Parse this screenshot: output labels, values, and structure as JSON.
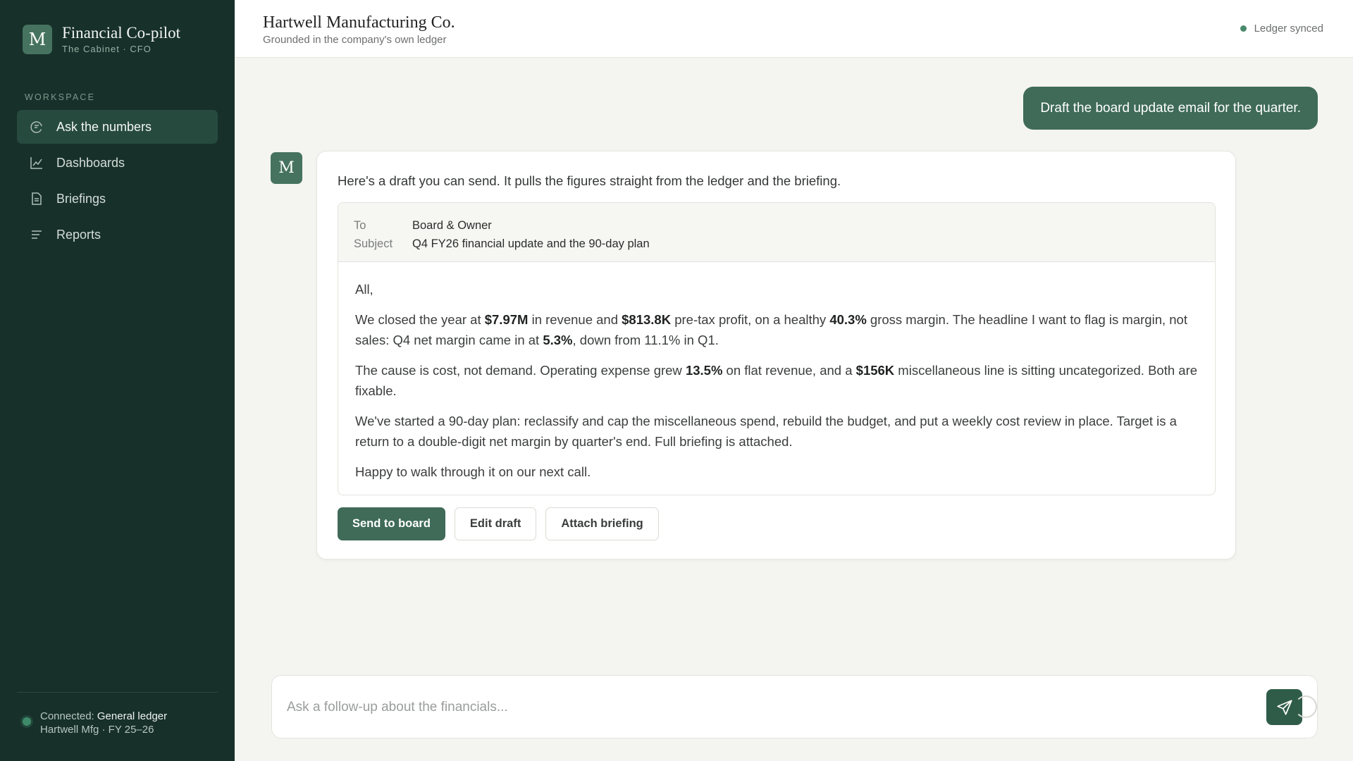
{
  "sidebar": {
    "logo_letter": "M",
    "title": "Financial Co-pilot",
    "subtitle": "The Cabinet · CFO",
    "section_label": "WORKSPACE",
    "items": [
      {
        "label": "Ask the numbers",
        "icon": "chat-icon",
        "active": true
      },
      {
        "label": "Dashboards",
        "icon": "line-chart-icon",
        "active": false
      },
      {
        "label": "Briefings",
        "icon": "document-icon",
        "active": false
      },
      {
        "label": "Reports",
        "icon": "list-icon",
        "active": false
      }
    ],
    "connection": {
      "prefix": "Connected: ",
      "source": "General ledger",
      "detail": "Hartwell Mfg · FY 25–26"
    }
  },
  "header": {
    "company": "Hartwell Manufacturing Co.",
    "tagline": "Grounded in the company's own ledger",
    "status": "Ledger synced"
  },
  "chat": {
    "user_message": "Draft the board update email for the quarter.",
    "assistant_avatar": "M",
    "assistant_intro": "Here's a draft you can send. It pulls the figures straight from the ledger and the briefing.",
    "email": {
      "to_label": "To",
      "to_value": "Board & Owner",
      "subject_label": "Subject",
      "subject_value": "Q4 FY26 financial update and the 90-day plan",
      "greeting": "All,",
      "p1": {
        "t1": "We closed the year at ",
        "revenue": "$7.97M",
        "t2": " in revenue and ",
        "profit": "$813.8K",
        "t3": " pre-tax profit, on a healthy ",
        "gross_margin": "40.3%",
        "t4": " gross margin. The headline I want to flag is margin, not sales: Q4 net margin came in at ",
        "net_margin": "5.3%",
        "t5": ", down from 11.1% in Q1."
      },
      "p2": {
        "t1": "The cause is cost, not demand. Operating expense grew ",
        "opex_growth": "13.5%",
        "t2": " on flat revenue, and a ",
        "misc": "$156K",
        "t3": " miscellaneous line is sitting uncategorized. Both are fixable."
      },
      "p3": "We've started a 90-day plan: reclassify and cap the miscellaneous spend, rebuild the budget, and put a weekly cost review in place. Target is a return to a double-digit net margin by quarter's end. Full briefing is attached.",
      "p4": "Happy to walk through it on our next call."
    },
    "actions": {
      "send": "Send to board",
      "edit": "Edit draft",
      "attach": "Attach briefing"
    }
  },
  "composer": {
    "placeholder": "Ask a follow-up about the financials...",
    "value": ""
  },
  "colors": {
    "sidebar_bg": "#17302a",
    "accent": "#3f6b58",
    "status_green": "#4a8a6c"
  }
}
